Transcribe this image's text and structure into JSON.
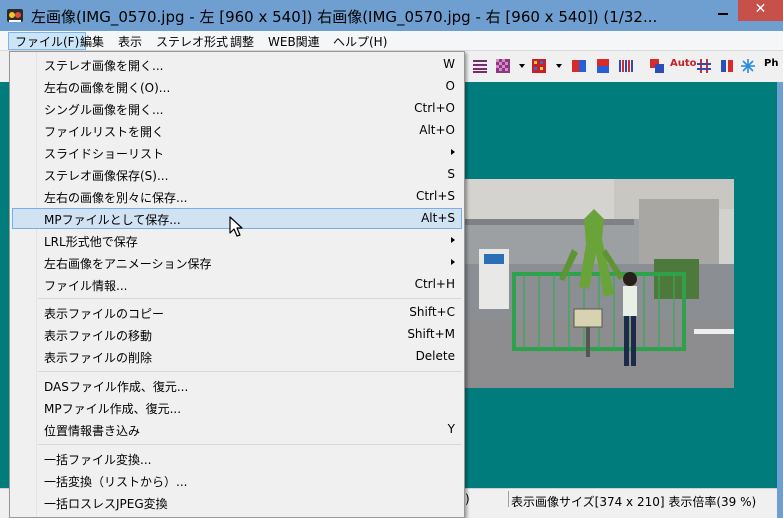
{
  "window": {
    "title": "左画像(IMG_0570.jpg - 左 [960 x 540]) 右画像(IMG_0570.jpg - 右 [960 x 540]) (1/32...",
    "close_label": "✕"
  },
  "menubar": {
    "items": [
      {
        "label": "ファイル(F)"
      },
      {
        "label": "編集"
      },
      {
        "label": "表示"
      },
      {
        "label": "ステレオ形式"
      },
      {
        "label": "調整"
      },
      {
        "label": "WEB関連"
      },
      {
        "label": "ヘルプ(H)"
      }
    ]
  },
  "toolbar": {
    "auto_label": "Auto",
    "ph_label": "Ph"
  },
  "file_menu": {
    "items": [
      {
        "label": "ステレオ画像を開く...",
        "shortcut": "W"
      },
      {
        "label": "左右の画像を開く(O)...",
        "shortcut": "O"
      },
      {
        "label": "シングル画像を開く...",
        "shortcut": "Ctrl+O"
      },
      {
        "label": "ファイルリストを開く",
        "shortcut": "Alt+O"
      },
      {
        "label": "スライドショーリスト",
        "shortcut": ""
      },
      {
        "label": "ステレオ画像保存(S)...",
        "shortcut": "S"
      },
      {
        "label": "左右の画像を別々に保存...",
        "shortcut": "Ctrl+S"
      },
      {
        "label": "MPファイルとして保存...",
        "shortcut": "Alt+S"
      },
      {
        "label": "LRL形式他で保存",
        "shortcut": ""
      },
      {
        "label": "左右画像をアニメーション保存",
        "shortcut": ""
      },
      {
        "label": "ファイル情報...",
        "shortcut": "Ctrl+H"
      },
      {
        "label": "表示ファイルのコピー",
        "shortcut": "Shift+C"
      },
      {
        "label": "表示ファイルの移動",
        "shortcut": "Shift+M"
      },
      {
        "label": "表示ファイルの削除",
        "shortcut": "Delete"
      },
      {
        "label": "DASファイル作成、復元...",
        "shortcut": ""
      },
      {
        "label": "MPファイル作成、復元...",
        "shortcut": ""
      },
      {
        "label": "位置情報書き込み",
        "shortcut": "Y"
      },
      {
        "label": "一括ファイル変換...",
        "shortcut": ""
      },
      {
        "label": "一括変換（リストから）...",
        "shortcut": ""
      },
      {
        "label": "一括ロスレスJPEG変換",
        "shortcut": ""
      }
    ]
  },
  "statusbar": {
    "left_fragment": ")",
    "info": "表示画像サイズ[374 x 210]  表示倍率(39 %)"
  }
}
